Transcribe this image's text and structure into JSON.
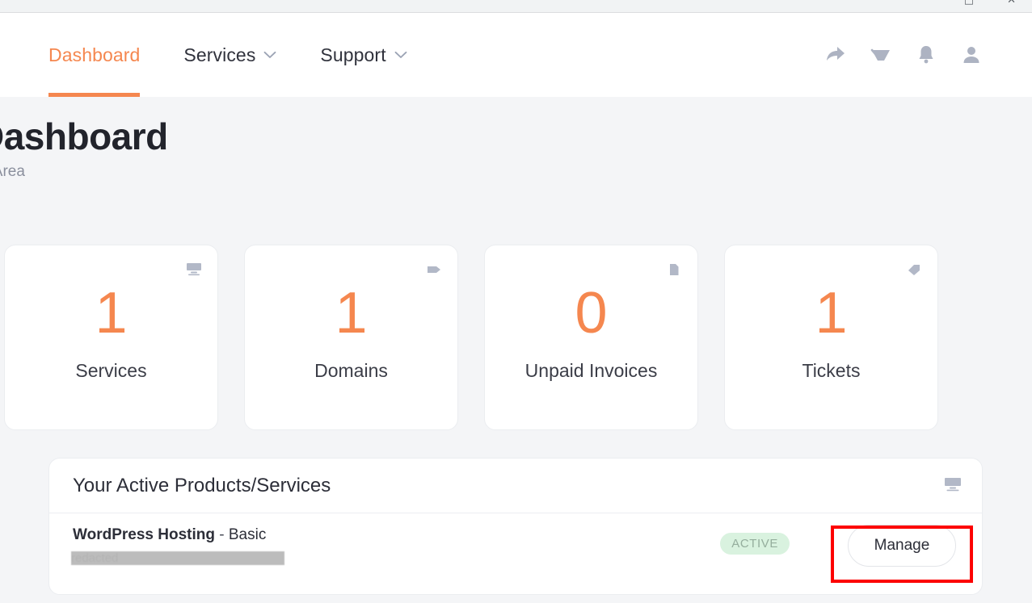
{
  "browser": {
    "maximize_icon": "maximize-icon",
    "close_icon": "close-icon"
  },
  "header": {
    "nav": [
      {
        "label": "Dashboard",
        "active": true,
        "has_caret": false
      },
      {
        "label": "Services",
        "active": false,
        "has_caret": true
      },
      {
        "label": "Support",
        "active": false,
        "has_caret": true
      }
    ],
    "icons": [
      {
        "name": "share-arrow-icon"
      },
      {
        "name": "shopping-cart-icon"
      },
      {
        "name": "notification-bell-icon"
      },
      {
        "name": "user-account-icon"
      }
    ],
    "accent_color": "#f5874f"
  },
  "page": {
    "title": "d",
    "title_full": "Dashboard",
    "subtitle": "ient Area",
    "subtitle_full": "Client Area",
    "background_color": "#f4f5f7"
  },
  "stats": [
    {
      "value": "1",
      "label": "Services",
      "icon": "monitor-icon"
    },
    {
      "value": "1",
      "label": "Domains",
      "icon": "tag-icon"
    },
    {
      "value": "0",
      "label": "Unpaid Invoices",
      "icon": "document-icon"
    },
    {
      "value": "1",
      "label": "Tickets",
      "icon": "ticket-tag-icon"
    }
  ],
  "products": {
    "panel_title": "Your Active Products/Services",
    "panel_icon": "monitor-icon",
    "rows": [
      {
        "product": "WordPress Hosting",
        "separator": " - ",
        "plan": "Basic",
        "domain": "redacted",
        "status": "ACTIVE",
        "status_bg": "#d9f2df",
        "status_fg": "#95ae9d",
        "action_label": "Manage"
      }
    ]
  },
  "annotation": {
    "name": "red-highlight-box",
    "color": "#fd0000",
    "target": "Manage"
  }
}
